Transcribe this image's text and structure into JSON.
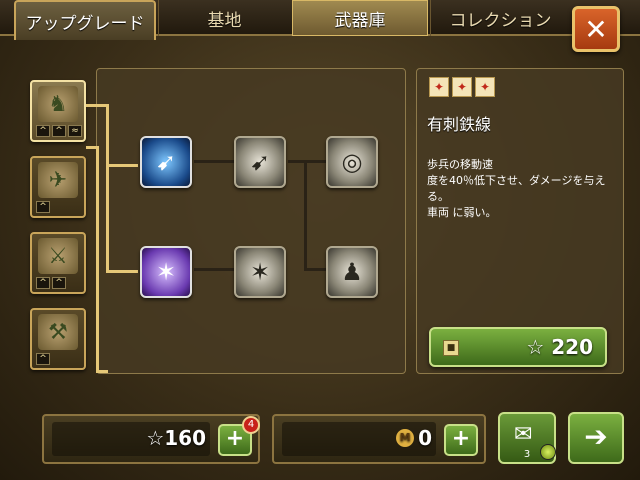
{
  "tabs": [
    {
      "label": "アップグレード"
    },
    {
      "label": "基地"
    },
    {
      "label": "武器庫"
    },
    {
      "label": "コレクション"
    }
  ],
  "close_label": "✕",
  "unit_icons": [
    "soldier-icon",
    "plane-icon",
    "artillery-icon",
    "aa-gun-icon"
  ],
  "tree_nodes": [
    {
      "icon": "bullet-icon",
      "glyph": "➹"
    },
    {
      "icon": "bullet-silver-icon",
      "glyph": "➹"
    },
    {
      "icon": "target-heart-icon",
      "glyph": "◎"
    },
    {
      "icon": "barbed-wire-icon",
      "glyph": "✶"
    },
    {
      "icon": "barbed-wire-silver-icon",
      "glyph": "✶"
    },
    {
      "icon": "soldier-statue-icon",
      "glyph": "♟"
    }
  ],
  "info": {
    "title": "有刺鉄線",
    "desc_line1": "歩兵の移動速",
    "desc_line2": "度を40％低下させ、ダメージを与える。",
    "desc_line3": "車両 に弱い。",
    "price": "☆ 220"
  },
  "bottom": {
    "stars": "☆160",
    "stars_badge": "4",
    "medals": "0",
    "plus": "+",
    "mail_count": "3",
    "next": "➔"
  },
  "colors": {
    "accent_gold": "#c9a55a",
    "button_green": "#5a8a2a",
    "close_orange": "#c24a18"
  }
}
